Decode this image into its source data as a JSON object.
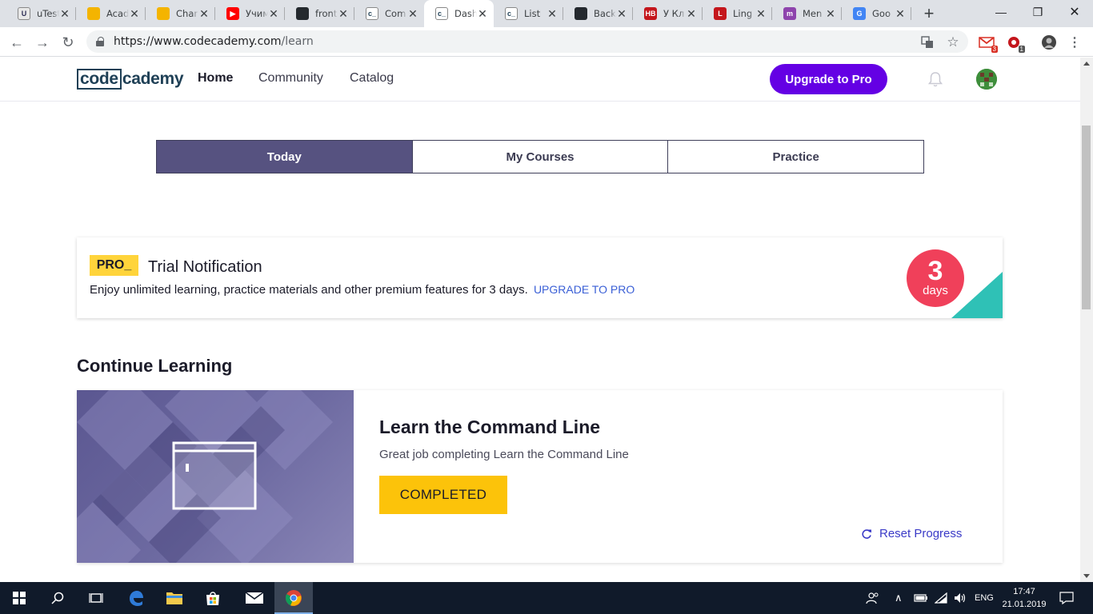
{
  "browser": {
    "tabs": [
      {
        "title": "uTest",
        "favicon_text": "U",
        "favicon_color": "#e8e8e8",
        "favicon_fg": "#2c2c54"
      },
      {
        "title": "Academy",
        "favicon_text": "",
        "favicon_color": "#f4b400"
      },
      {
        "title": "Chart",
        "favicon_text": "",
        "favicon_color": "#f4b400"
      },
      {
        "title": "Учим",
        "favicon_text": "▶",
        "favicon_color": "#ff0000"
      },
      {
        "title": "front",
        "favicon_text": "",
        "favicon_color": "#24292e"
      },
      {
        "title": "Com",
        "favicon_text": "c_",
        "favicon_color": "#ffffff",
        "favicon_fg": "#1f4056"
      },
      {
        "title": "Dash",
        "favicon_text": "c_",
        "favicon_color": "#ffffff",
        "favicon_fg": "#1f4056",
        "active": true
      },
      {
        "title": "List",
        "favicon_text": "c_",
        "favicon_color": "#ffffff",
        "favicon_fg": "#1f4056"
      },
      {
        "title": "Back",
        "favicon_text": "",
        "favicon_color": "#24292e"
      },
      {
        "title": "У Кл",
        "favicon_text": "НВ",
        "favicon_color": "#c4161c"
      },
      {
        "title": "Ling",
        "favicon_text": "L",
        "favicon_color": "#c4161c"
      },
      {
        "title": "Men",
        "favicon_text": "m",
        "favicon_color": "#8e44ad"
      },
      {
        "title": "Goo",
        "favicon_text": "G",
        "favicon_color": "#4285f4"
      }
    ],
    "url_host": "https://www.codecademy.com",
    "url_path": "/learn",
    "gmail_badge": "3",
    "ext_badge": "1"
  },
  "header": {
    "logo_box": "code",
    "logo_rest": "cademy",
    "nav": [
      "Home",
      "Community",
      "Catalog"
    ],
    "upgrade_label": "Upgrade to Pro"
  },
  "segments": [
    "Today",
    "My Courses",
    "Practice"
  ],
  "trial": {
    "badge": "PRO_",
    "title": "Trial Notification",
    "text": "Enjoy unlimited learning, practice materials and other premium features for 3 days.",
    "link": "UPGRADE TO PRO",
    "days_number": "3",
    "days_label": "days"
  },
  "continue": {
    "heading": "Continue Learning",
    "course_title": "Learn the Command Line",
    "course_subtitle": "Great job completing Learn the Command Line",
    "status_button": "COMPLETED",
    "reset_label": "Reset Progress"
  },
  "taskbar": {
    "language": "ENG",
    "time": "17:47",
    "date": "21.01.2019"
  },
  "colors": {
    "brand_purple": "#6400e4",
    "segment_active": "#565280",
    "pro_yellow": "#ffd43b",
    "days_red": "#f0405a",
    "teal": "#2fc1b6",
    "completed_yellow": "#fcc30a"
  }
}
